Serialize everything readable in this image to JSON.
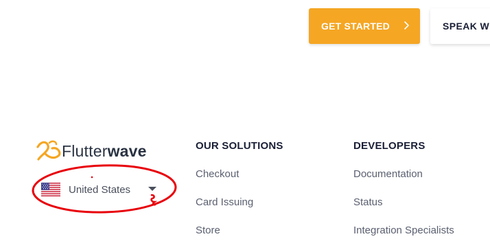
{
  "header": {
    "get_started_label": "GET STARTED",
    "speak_label": "SPEAK WITH SALES"
  },
  "logo": {
    "text_light": "Flutter",
    "text_bold": "wave",
    "brand_color": "#f5a623"
  },
  "country_selector": {
    "selected": "United States",
    "flag_icon": "us-flag-icon"
  },
  "footer": {
    "solutions": {
      "heading": "OUR SOLUTIONS",
      "links": [
        "Checkout",
        "Card Issuing",
        "Store"
      ]
    },
    "developers": {
      "heading": "DEVELOPERS",
      "links": [
        "Documentation",
        "Status",
        "Integration Specialists"
      ]
    }
  },
  "colors": {
    "accent": "#f5a623",
    "annotation": "#e8000a",
    "heading": "#1a1f36",
    "link": "#5b6070"
  }
}
